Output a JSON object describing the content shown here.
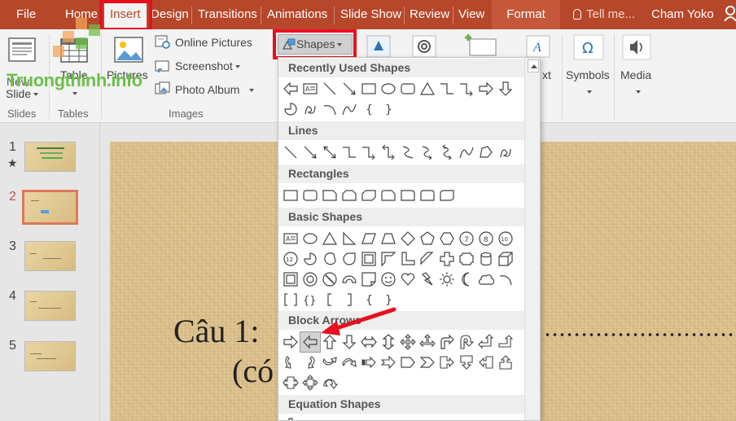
{
  "tabs": [
    {
      "label": "File"
    },
    {
      "label": "Home"
    },
    {
      "label": "Insert"
    },
    {
      "label": "Design"
    },
    {
      "label": "Transitions"
    },
    {
      "label": "Animations"
    },
    {
      "label": "Slide Show"
    },
    {
      "label": "Review"
    },
    {
      "label": "View"
    },
    {
      "label": "Format"
    }
  ],
  "tell_me": "Tell me...",
  "user_name": "Cham Yoko",
  "ribbon": {
    "new_slide_label": "Slide",
    "new_slide_top": "New",
    "table_label": "Table",
    "pictures_label": "Pictures",
    "online_pictures": "Online Pictures",
    "screenshot": "Screenshot",
    "photo_album": "Photo Album",
    "shapes_button": "Shapes",
    "text_label": "xt",
    "symbols_label": "Symbols",
    "media_label": "Media",
    "group_slides": "Slides",
    "group_tables": "Tables",
    "group_images": "Images"
  },
  "watermark": "Truongthinh.info",
  "thumbnails": [
    {
      "num": "1",
      "star": "★"
    },
    {
      "num": "2"
    },
    {
      "num": "3"
    },
    {
      "num": "4"
    },
    {
      "num": "5"
    }
  ],
  "slide": {
    "line1": "Câu 1:",
    "line2": "(có"
  },
  "dropdown": {
    "sections": [
      {
        "title": "Recently Used Shapes"
      },
      {
        "title": "Lines"
      },
      {
        "title": "Rectangles"
      },
      {
        "title": "Basic Shapes"
      },
      {
        "title": "Block Arrows"
      },
      {
        "title": "Equation Shapes"
      }
    ]
  },
  "colors": {
    "accent": "#b7472a",
    "highlight": "#e8101e",
    "slide_bg": "#dcc08c"
  }
}
